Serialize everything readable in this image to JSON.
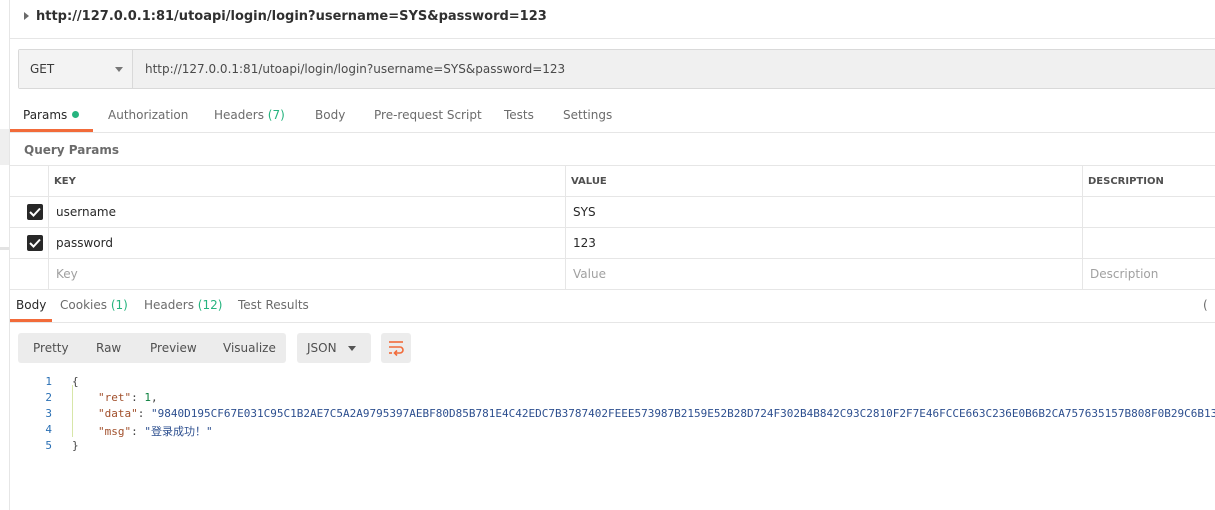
{
  "request": {
    "title": "http://127.0.0.1:81/utoapi/login/login?username=SYS&password=123",
    "method": "GET",
    "url": "http://127.0.0.1:81/utoapi/login/login?username=SYS&password=123"
  },
  "request_tabs": {
    "params": "Params",
    "authorization": "Authorization",
    "headers": "Headers",
    "headers_count": "(7)",
    "body": "Body",
    "prerequest": "Pre-request Script",
    "tests": "Tests",
    "settings": "Settings"
  },
  "query_params": {
    "title": "Query Params",
    "headers": {
      "key": "KEY",
      "value": "VALUE",
      "description": "DESCRIPTION"
    },
    "rows": [
      {
        "key": "username",
        "value": "SYS",
        "checked": true
      },
      {
        "key": "password",
        "value": "123",
        "checked": true
      }
    ],
    "placeholders": {
      "key": "Key",
      "value": "Value",
      "description": "Description"
    }
  },
  "response_tabs": {
    "body": "Body",
    "cookies": "Cookies",
    "cookies_count": "(1)",
    "headers": "Headers",
    "headers_count": "(12)",
    "test_results": "Test Results",
    "clipped_paren": "("
  },
  "view_buttons": {
    "pretty": "Pretty",
    "raw": "Raw",
    "preview": "Preview",
    "visualize": "Visualize"
  },
  "format": "JSON",
  "code": {
    "line_numbers": [
      "1",
      "2",
      "3",
      "4",
      "5"
    ],
    "open_brace": "{",
    "ret_key": "\"ret\"",
    "ret_value": "1",
    "data_key": "\"data\"",
    "data_value": "\"9840D195CF67E031C95C1B2AE7C5A2A9795397AEBF80D85B781E4C42EDC7B3787402FEEE573987B2159E52B28D724F302B4B842C93C2810F2F7E46FCCE663C236E0B6B2CA757635157B808F0B29C6B13",
    "msg_key": "\"msg\"",
    "msg_value": "\"登录成功！\"",
    "close_brace": "}"
  },
  "colors": {
    "accent": "#f26b3a",
    "green": "#26b47f"
  }
}
